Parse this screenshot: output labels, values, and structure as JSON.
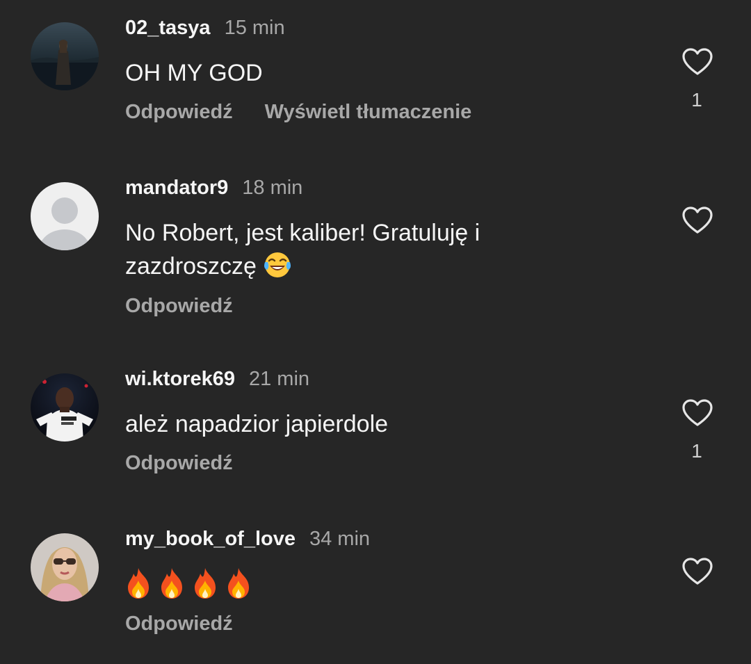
{
  "comments": [
    {
      "username": "02_tasya",
      "time": "15 min",
      "text": "OH MY GOD",
      "reply_label": "Odpowiedź",
      "translate_label": "Wyświetl tłumaczenie",
      "like_count": "1",
      "avatar_icon": "avatar-photo-silhouette"
    },
    {
      "username": "mandator9",
      "time": "18 min",
      "text": "No Robert, jest kaliber! Gratuluję i zazdroszczę",
      "emoji": "😂",
      "reply_label": "Odpowiedź",
      "like_count": "",
      "avatar_icon": "default-avatar"
    },
    {
      "username": "wi.ktorek69",
      "time": "21 min",
      "text": "ależ napadzior japierdole",
      "reply_label": "Odpowiedź",
      "like_count": "1",
      "avatar_icon": "avatar-photo-footballer"
    },
    {
      "username": "my_book_of_love",
      "time": "34 min",
      "text": "🔥🔥🔥🔥",
      "reply_label": "Odpowiedź",
      "like_count": "",
      "avatar_icon": "avatar-photo-woman"
    }
  ],
  "icons": {
    "like": "heart-outline-icon",
    "fire": "fire-emoji",
    "laugh": "face-with-tears-of-joy-emoji"
  },
  "colors": {
    "background": "#262626",
    "primary_text": "#f5f5f5",
    "secondary_text": "#a8a8a8"
  }
}
